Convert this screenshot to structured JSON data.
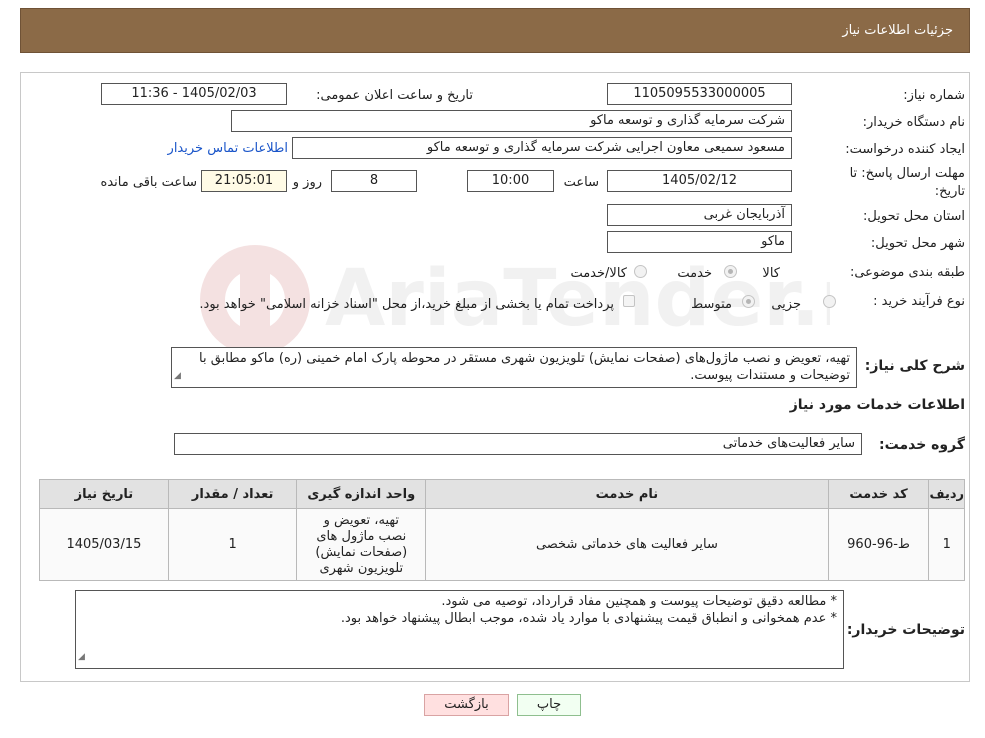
{
  "header": {
    "title": "جزئیات اطلاعات نیاز"
  },
  "form": {
    "need_number_label": "شماره نیاز:",
    "need_number": "1105095533000005",
    "announce_label": "تاریخ و ساعت اعلان عمومی:",
    "announce_value": "1405/02/03 - 11:36",
    "buyer_org_label": "نام دستگاه خریدار:",
    "buyer_org": "شرکت سرمایه گذاری و توسعه ماکو",
    "creator_label": "ایجاد کننده درخواست:",
    "creator": "مسعود سمیعی معاون اجرایی شرکت سرمایه گذاری و توسعه ماکو",
    "contact_link": "اطلاعات تماس خریدار",
    "deadline_label_1": "مهلت ارسال پاسخ: تا",
    "deadline_label_2": "تاریخ:",
    "deadline_date": "1405/02/12",
    "time_label": "ساعت",
    "deadline_time": "10:00",
    "days_value": "8",
    "days_label": "روز و",
    "remaining_value": "21:05:01",
    "remaining_label": "ساعت باقی مانده",
    "province_label": "استان محل تحویل:",
    "province": "آذربایجان غربی",
    "city_label": "شهر محل تحویل:",
    "city": "ماکو",
    "category_label": "طبقه بندی موضوعی:",
    "category_options": [
      "کالا",
      "خدمت",
      "کالا/خدمت"
    ],
    "process_label": "نوع فرآیند خرید :",
    "process_options": [
      "جزیی",
      "متوسط"
    ],
    "payment_note": "پرداخت تمام یا بخشی از مبلغ خرید،از محل \"اسناد خزانه اسلامی\" خواهد بود."
  },
  "description": {
    "label": "شرح کلی نیاز:",
    "text": "تهیه، تعویض و نصب ماژول‌های (صفحات نمایش) تلویزیون شهری مستقر در محوطه پارک امام خمینی (ره) ماکو مطابق با توضیحات و مستندات پیوست."
  },
  "services": {
    "section_title": "اطلاعات خدمات مورد نیاز",
    "group_label": "گروه خدمت:",
    "group_value": "سایر فعالیت‌های خدماتی",
    "columns": [
      "ردیف",
      "کد خدمت",
      "نام خدمت",
      "واحد اندازه گیری",
      "تعداد / مقدار",
      "تاریخ نیاز"
    ],
    "rows": [
      {
        "row": "1",
        "code": "ط-96-960",
        "name": "سایر فعالیت های خدماتی شخصی",
        "unit": "تهیه، تعویض و نصب ماژول های (صفحات نمایش) تلویزیون شهری",
        "qty": "1",
        "date": "1405/03/15"
      }
    ]
  },
  "buyer_notes": {
    "label": "توضیحات خریدار:",
    "line1": "* مطالعه دقیق توضیحات پیوست و همچنین مفاد قرارداد، توصیه می شود.",
    "line2": "* عدم همخوانی و انطباق قیمت پیشنهادی با موارد یاد شده، موجب ابطال پیشنهاد خواهد بود."
  },
  "buttons": {
    "print": "چاپ",
    "back": "بازگشت"
  },
  "watermark": {
    "text": "AriaTender.neT"
  },
  "colors": {
    "header_bg": "#8b6a47",
    "link": "#1a55c9",
    "back_btn": "#ffe0e0",
    "print_btn": "#f2fff2"
  }
}
